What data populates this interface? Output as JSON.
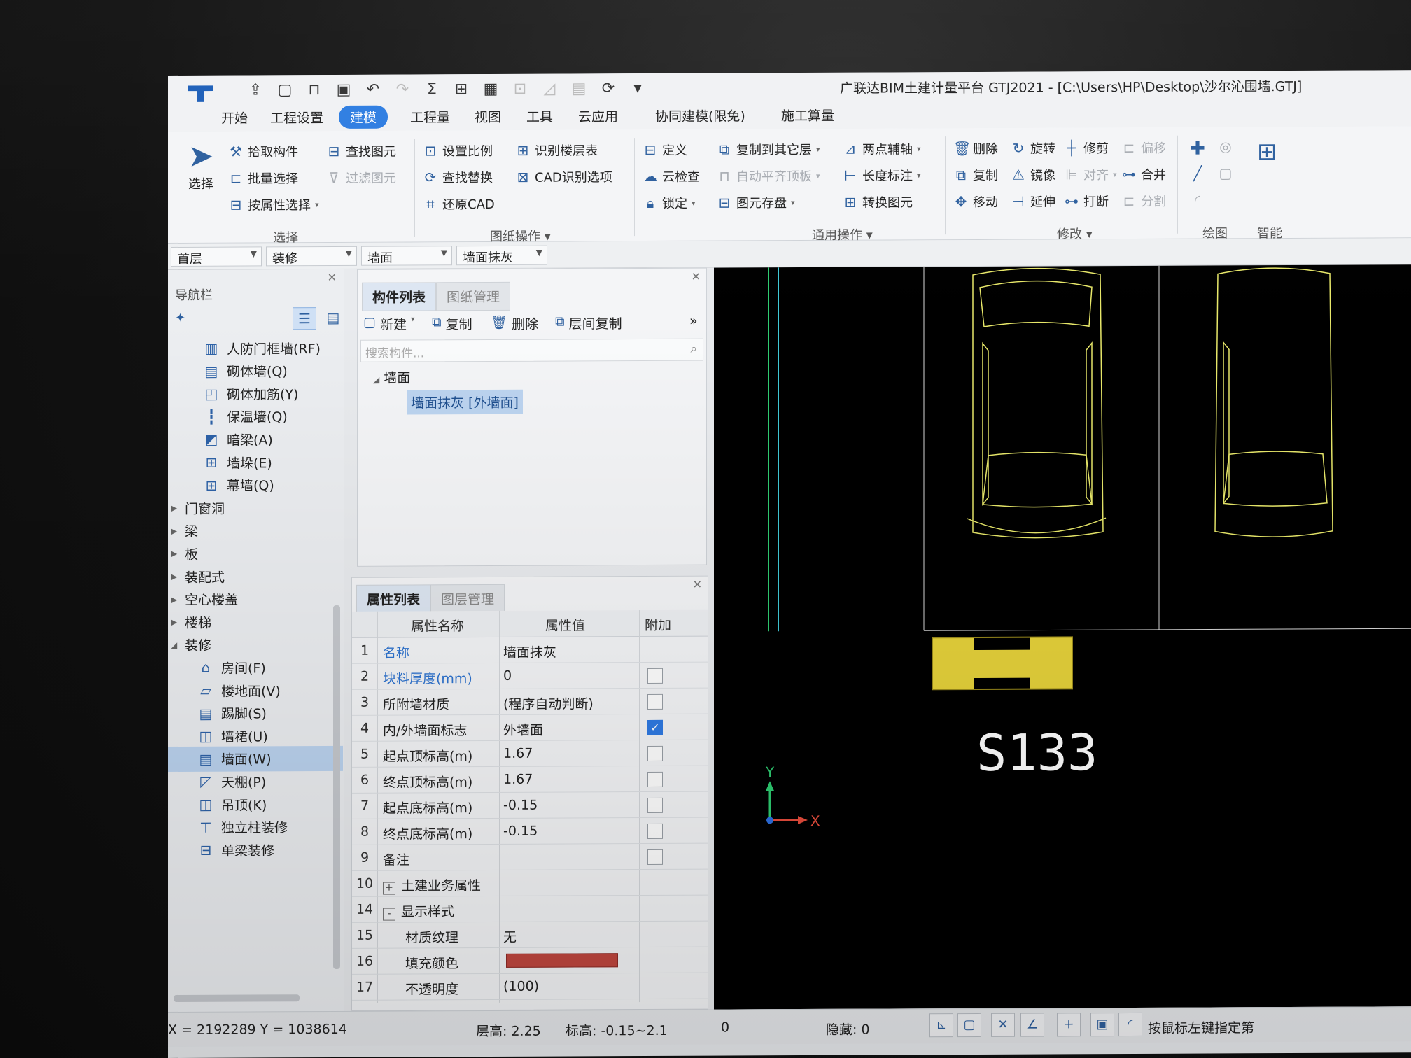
{
  "window": {
    "title": "广联达BIM土建计量平台 GTJ2021 - [C:\\Users\\HP\\Desktop\\沙尔沁围墙.GTJ]",
    "logo": "T"
  },
  "menu": {
    "tabs": [
      "开始",
      "工程设置",
      "建模",
      "工程量",
      "视图",
      "工具",
      "云应用",
      "协同建模(限免)",
      "施工算量"
    ]
  },
  "ribbon": {
    "select_group": {
      "big_button": "选择",
      "items": [
        "拾取构件",
        "批量选择",
        "按属性选择",
        "查找图元",
        "过滤图元"
      ],
      "label": "选择"
    },
    "drawing_group": {
      "items": [
        "设置比例",
        "识别楼层表",
        "查找替换",
        "CAD识别选项",
        "还原CAD"
      ],
      "label": "图纸操作"
    },
    "common_group": {
      "items": [
        "定义",
        "复制到其它层",
        "两点辅轴",
        "云检查",
        "自动平齐顶板",
        "长度标注",
        "锁定",
        "图元存盘",
        "转换图元"
      ],
      "label": "通用操作"
    },
    "modify_group": {
      "items": [
        "删除",
        "旋转",
        "修剪",
        "偏移",
        "复制",
        "镜像",
        "对齐",
        "合并",
        "移动",
        "延伸",
        "打断",
        "分割"
      ],
      "label": "修改"
    },
    "draw_group": {
      "label": "绘图"
    },
    "smart_group": {
      "label": "智能"
    }
  },
  "combos": {
    "floor": "首层",
    "category": "装修",
    "type": "墙面",
    "component": "墙面抹灰"
  },
  "nav": {
    "title": "导航栏",
    "items": [
      {
        "label": "人防门框墙(RF)",
        "icon": "door-frame-wall-icon",
        "kind": "leaf"
      },
      {
        "label": "砌体墙(Q)",
        "icon": "masonry-wall-icon",
        "kind": "leaf"
      },
      {
        "label": "砌体加筋(Y)",
        "icon": "masonry-rebar-icon",
        "kind": "leaf"
      },
      {
        "label": "保温墙(Q)",
        "icon": "insulation-wall-icon",
        "kind": "leaf"
      },
      {
        "label": "暗梁(A)",
        "icon": "hidden-beam-icon",
        "kind": "leaf"
      },
      {
        "label": "墙垛(E)",
        "icon": "wall-pier-icon",
        "kind": "leaf"
      },
      {
        "label": "幕墙(Q)",
        "icon": "curtain-wall-icon",
        "kind": "leaf"
      },
      {
        "label": "门窗洞",
        "kind": "group-collapsed"
      },
      {
        "label": "梁",
        "kind": "group-collapsed"
      },
      {
        "label": "板",
        "kind": "group-collapsed"
      },
      {
        "label": "装配式",
        "kind": "group-collapsed"
      },
      {
        "label": "空心楼盖",
        "kind": "group-collapsed"
      },
      {
        "label": "楼梯",
        "kind": "group-collapsed"
      },
      {
        "label": "装修",
        "kind": "group-expanded"
      },
      {
        "label": "房间(F)",
        "icon": "room-icon",
        "kind": "leaf"
      },
      {
        "label": "楼地面(V)",
        "icon": "floor-finish-icon",
        "kind": "leaf"
      },
      {
        "label": "踢脚(S)",
        "icon": "skirting-icon",
        "kind": "leaf"
      },
      {
        "label": "墙裙(U)",
        "icon": "dado-icon",
        "kind": "leaf"
      },
      {
        "label": "墙面(W)",
        "icon": "wall-finish-icon",
        "kind": "leaf",
        "selected": true
      },
      {
        "label": "天棚(P)",
        "icon": "ceiling-icon",
        "kind": "leaf"
      },
      {
        "label": "吊顶(K)",
        "icon": "suspended-ceiling-icon",
        "kind": "leaf"
      },
      {
        "label": "独立柱装修",
        "icon": "column-finish-icon",
        "kind": "leaf"
      },
      {
        "label": "单梁装修",
        "icon": "beam-finish-icon",
        "kind": "leaf"
      }
    ]
  },
  "component_panel": {
    "tabs": [
      "构件列表",
      "图纸管理"
    ],
    "toolbar": [
      "新建",
      "复制",
      "删除",
      "层间复制"
    ],
    "search_placeholder": "搜索构件...",
    "tree_root": "墙面",
    "tree_child": "墙面抹灰 [外墙面]"
  },
  "property_panel": {
    "tabs": [
      "属性列表",
      "图层管理"
    ],
    "headers": [
      "属性名称",
      "属性值",
      "附加"
    ],
    "rows": [
      {
        "no": "1",
        "name": "名称",
        "value": "墙面抹灰",
        "blue": true,
        "check": null
      },
      {
        "no": "2",
        "name": "块料厚度(mm)",
        "value": "0",
        "blue": true,
        "check": false
      },
      {
        "no": "3",
        "name": "所附墙材质",
        "value": "(程序自动判断)",
        "blue": false,
        "check": false
      },
      {
        "no": "4",
        "name": "内/外墙面标志",
        "value": "外墙面",
        "blue": false,
        "check": true
      },
      {
        "no": "5",
        "name": "起点顶标高(m)",
        "value": "1.67",
        "blue": false,
        "check": false
      },
      {
        "no": "6",
        "name": "终点顶标高(m)",
        "value": "1.67",
        "blue": false,
        "check": false
      },
      {
        "no": "7",
        "name": "起点底标高(m)",
        "value": "-0.15",
        "blue": false,
        "check": false
      },
      {
        "no": "8",
        "name": "终点底标高(m)",
        "value": "-0.15",
        "blue": false,
        "check": false
      },
      {
        "no": "9",
        "name": "备注",
        "value": "",
        "blue": false,
        "check": false
      },
      {
        "no": "10",
        "name": "土建业务属性",
        "value": "",
        "blue": false,
        "check": null,
        "expander": "+"
      },
      {
        "no": "14",
        "name": "显示样式",
        "value": "",
        "blue": false,
        "check": null,
        "expander": "-"
      },
      {
        "no": "15",
        "name": "材质纹理",
        "value": "无",
        "blue": false,
        "check": null,
        "indent": true
      },
      {
        "no": "16",
        "name": "填充颜色",
        "value": "",
        "blue": false,
        "check": null,
        "indent": true,
        "swatch": "#c0463f"
      },
      {
        "no": "17",
        "name": "不透明度",
        "value": "(100)",
        "blue": false,
        "check": null,
        "indent": true
      }
    ]
  },
  "canvas": {
    "label": "S133",
    "axis_x": "X",
    "axis_y": "Y",
    "wall_color": "#e6d23a"
  },
  "status": {
    "coords": "X = 2192289 Y = 1038614",
    "floor_height": "层高:  2.25",
    "elevation": "标高:  -0.15~2.1",
    "count": "0",
    "hidden": "隐藏:  0",
    "hint": "按鼠标左键指定第"
  },
  "colors": {
    "accent": "#2e7de1",
    "selection": "#bcd4f0",
    "canvas_bg": "#000000"
  }
}
